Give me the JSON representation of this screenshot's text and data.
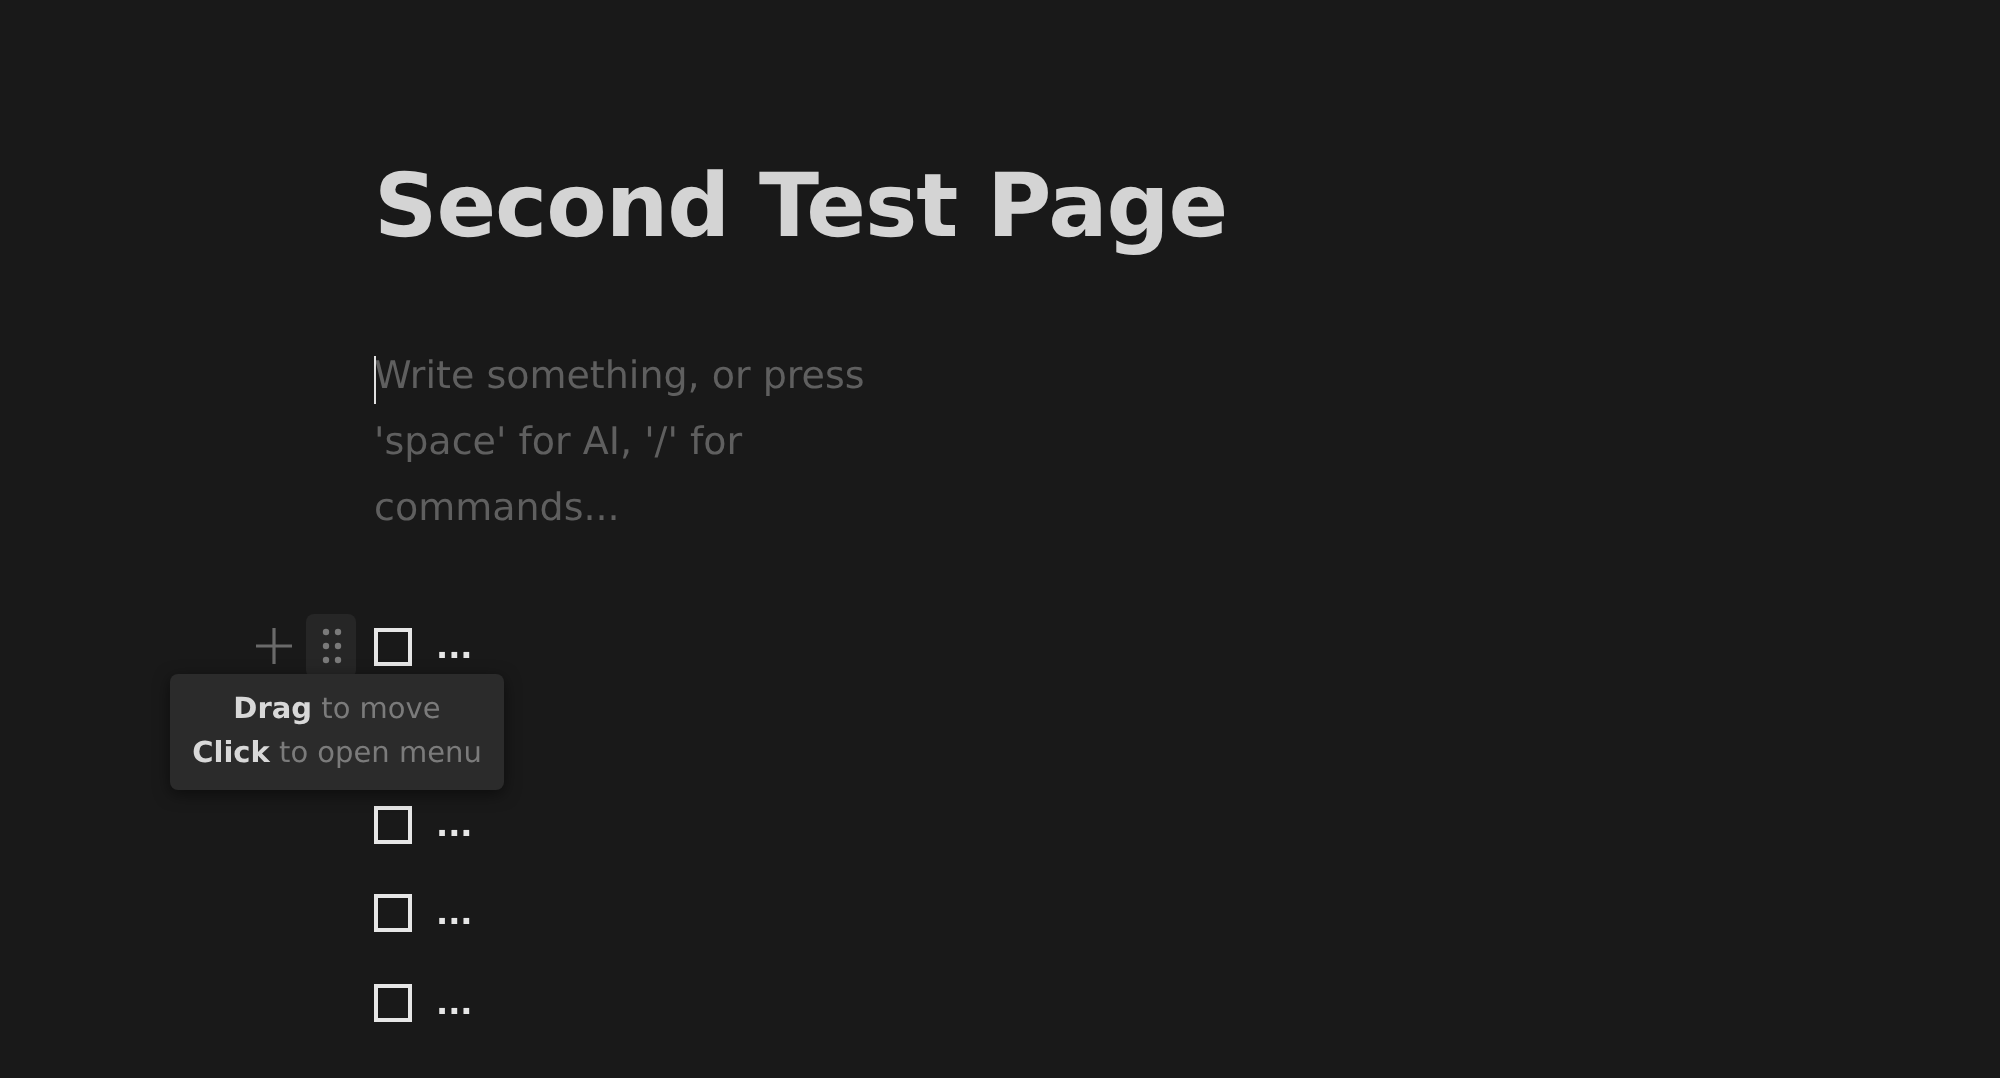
{
  "page": {
    "title": "Second Test Page",
    "placeholder": "Write something, or press 'space' for AI, '/' for commands..."
  },
  "todos": [
    {
      "text": "...",
      "checked": false,
      "hovered": true
    },
    {
      "text": "...",
      "checked": false,
      "hovered": false
    },
    {
      "text": "...",
      "checked": false,
      "hovered": false
    },
    {
      "text": "...",
      "checked": false,
      "hovered": false
    }
  ],
  "tooltip": {
    "lines": [
      "**Drag** to move",
      "**Click** to open menu"
    ]
  }
}
